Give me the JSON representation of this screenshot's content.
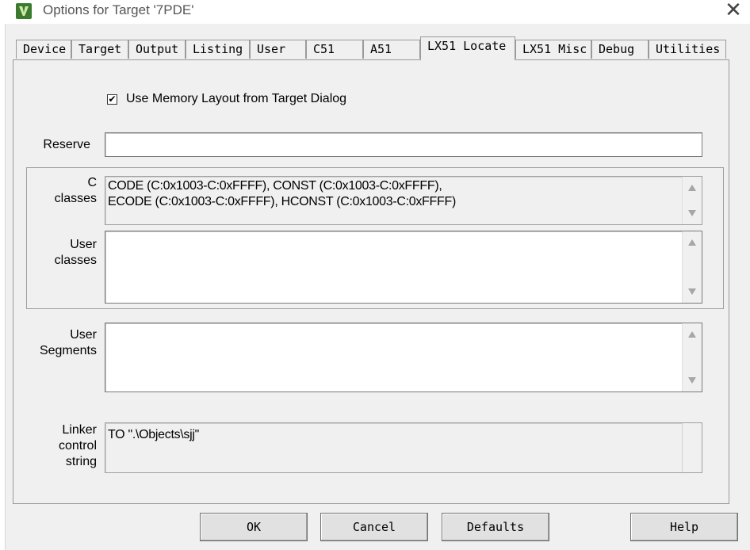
{
  "window": {
    "title": "Options for Target '7PDE'",
    "close_glyph": "✕",
    "icon": "keil-uvision-icon"
  },
  "tabs": [
    {
      "label": "Device"
    },
    {
      "label": "Target"
    },
    {
      "label": "Output"
    },
    {
      "label": "Listing"
    },
    {
      "label": "User"
    },
    {
      "label": "C51"
    },
    {
      "label": "A51"
    },
    {
      "label": "LX51 Locate",
      "active": true
    },
    {
      "label": "LX51 Misc"
    },
    {
      "label": "Debug"
    },
    {
      "label": "Utilities"
    }
  ],
  "options": {
    "use_memory_layout": {
      "label": "Use Memory Layout from Target Dialog",
      "checked": true,
      "glyph": "✔"
    }
  },
  "fields": {
    "reserve": {
      "label": "Reserve",
      "value": ""
    },
    "c_classes": {
      "label_line1": "C",
      "label_line2": "classes",
      "line1": "CODE (C:0x1003-C:0xFFFF), CONST (C:0x1003-C:0xFFFF),",
      "line2": "ECODE (C:0x1003-C:0xFFFF), HCONST (C:0x1003-C:0xFFFF)"
    },
    "user_classes": {
      "label_line1": "User",
      "label_line2": "classes",
      "value": ""
    },
    "user_segments": {
      "label_line1": "User",
      "label_line2": "Segments",
      "value": ""
    },
    "linker_control": {
      "label_line1": "Linker",
      "label_line2": "control",
      "label_line3": "string",
      "value": "TO \".\\Objects\\sjj\""
    }
  },
  "buttons": {
    "ok": "OK",
    "cancel": "Cancel",
    "defaults": "Defaults",
    "help": "Help"
  }
}
